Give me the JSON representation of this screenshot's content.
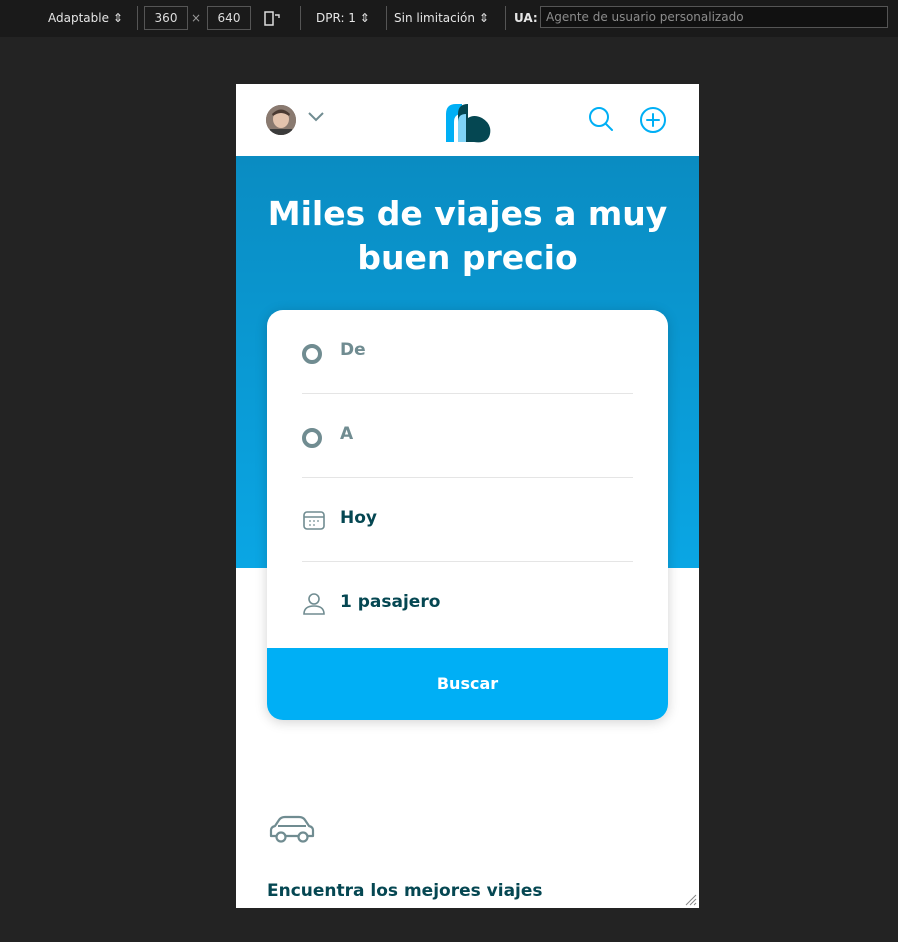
{
  "devtools": {
    "mode": "Adaptable",
    "width": "360",
    "times": "×",
    "height": "640",
    "dpr": "DPR: 1",
    "throttle": "Sin limitación",
    "ua_label": "UA:",
    "ua_placeholder": "Agente de usuario personalizado"
  },
  "header": {
    "avatar": "user-avatar",
    "menu_icon": "chevron-down-icon",
    "logo": "blablacar-logo",
    "search_icon": "search-icon",
    "add_icon": "plus-circle-icon"
  },
  "hero": {
    "title_line1": "Miles de viajes a muy",
    "title_line2": "buen precio"
  },
  "search_form": {
    "from_label": "De",
    "to_label": "A",
    "date_value": "Hoy",
    "passengers_value": "1 pasajero",
    "submit_label": "Buscar"
  },
  "section": {
    "icon": "car-icon",
    "title": "Encuentra los mejores viajes"
  },
  "colors": {
    "hero_blue": "#0a9bd6",
    "button_blue": "#00aff5",
    "text_dark": "#054752",
    "text_muted": "#708c91"
  }
}
